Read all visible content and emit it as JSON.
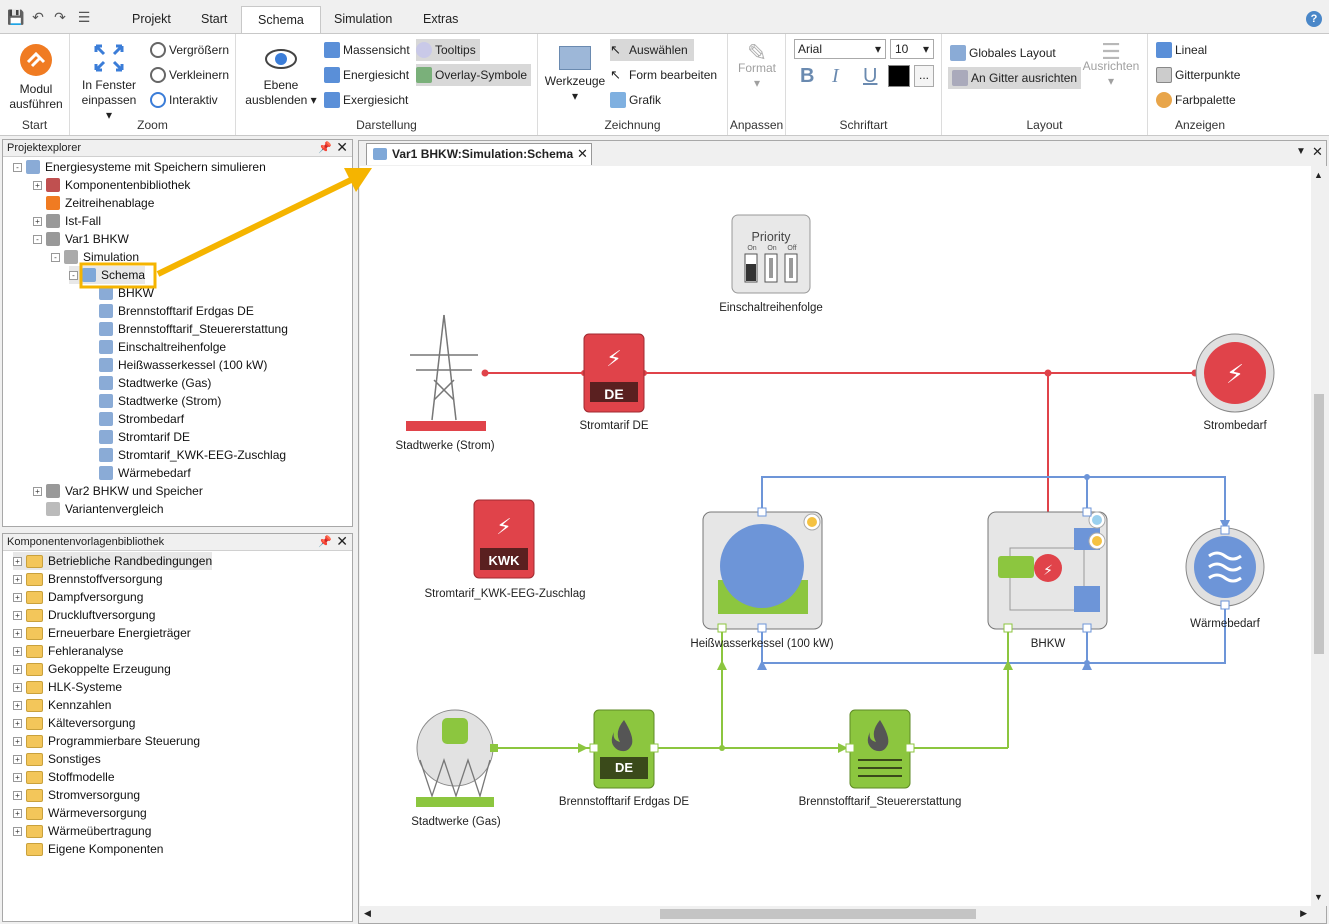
{
  "ribbon_tabs": [
    "Projekt",
    "Start",
    "Schema",
    "Simulation",
    "Extras"
  ],
  "active_tab": "Schema",
  "ribbon": {
    "start": {
      "label": "Start",
      "modul": "Modul",
      "ausfuehren": "ausführen"
    },
    "zoom": {
      "label": "Zoom",
      "in_fenster": "In Fenster",
      "einpassen": "einpassen",
      "vergroessern": "Vergrößern",
      "verkleinern": "Verkleinern",
      "interaktiv": "Interaktiv"
    },
    "darstellung": {
      "label": "Darstellung",
      "ebene": "Ebene",
      "ausblenden": "ausblenden",
      "massensicht": "Massensicht",
      "energiesicht": "Energiesicht",
      "exergiesicht": "Exergiesicht",
      "tooltips": "Tooltips",
      "overlay": "Overlay-Symbole"
    },
    "zeichnung": {
      "label": "Zeichnung",
      "werkzeuge": "Werkzeuge",
      "auswaehlen": "Auswählen",
      "form": "Form bearbeiten",
      "grafik": "Grafik"
    },
    "anpassen": {
      "label": "Anpassen",
      "format": "Format"
    },
    "schriftart": {
      "label": "Schriftart",
      "font": "Arial",
      "size": "10",
      "bold": "B",
      "italic": "I",
      "underline": "U",
      "more": "..."
    },
    "layout": {
      "label": "Layout",
      "globales": "Globales Layout",
      "gitter": "An Gitter ausrichten",
      "ausrichten": "Ausrichten"
    },
    "anzeigen": {
      "label": "Anzeigen",
      "lineal": "Lineal",
      "gitterpunkte": "Gitterpunkte",
      "farbpalette": "Farbpalette"
    }
  },
  "projektexplorer": {
    "title": "Projektexplorer",
    "items": [
      "Energiesysteme mit Speichern simulieren",
      "Komponentenbibliothek",
      "Zeitreihenablage",
      "Ist-Fall",
      "Var1 BHKW",
      "Simulation",
      "Schema",
      "BHKW",
      "Brennstofftarif Erdgas DE",
      "Brennstofftarif_Steuererstattung",
      "Einschaltreihenfolge",
      "Heißwasserkessel (100 kW)",
      "Stadtwerke (Gas)",
      "Stadtwerke (Strom)",
      "Strombedarf",
      "Stromtarif DE",
      "Stromtarif_KWK-EEG-Zuschlag",
      "Wärmebedarf",
      "Var2 BHKW und Speicher",
      "Variantenvergleich"
    ]
  },
  "bibliothek": {
    "title": "Komponentenvorlagenbibliothek",
    "items": [
      "Betriebliche Randbedingungen",
      "Brennstoffversorgung",
      "Dampfversorgung",
      "Druckluftversorgung",
      "Erneuerbare Energieträger",
      "Fehleranalyse",
      "Gekoppelte Erzeugung",
      "HLK-Systeme",
      "Kennzahlen",
      "Kälteversorgung",
      "Programmierbare Steuerung",
      "Sonstiges",
      "Stoffmodelle",
      "Stromversorgung",
      "Wärmeversorgung",
      "Wärmeübertragung",
      "Eigene Komponenten"
    ]
  },
  "document_tab": "Var1 BHKW:Simulation:Schema",
  "schema": {
    "priority_title": "Priority",
    "priority_states": [
      "On",
      "On",
      "Off"
    ],
    "labels": {
      "einschalt": "Einschaltreihenfolge",
      "stadtwerke_strom": "Stadtwerke (Strom)",
      "stromtarif": "Stromtarif DE",
      "strombedarf": "Strombedarf",
      "kwk": "Stromtarif_KWK-EEG-Zuschlag",
      "kessel": "Heißwasserkessel (100 kW)",
      "bhkw": "BHKW",
      "waermebedarf": "Wärmebedarf",
      "stadtwerke_gas": "Stadtwerke (Gas)",
      "brennstoff_erdgas": "Brennstofftarif Erdgas DE",
      "brennstoff_steuer": "Brennstofftarif_Steuererstattung"
    },
    "badge_de": "DE",
    "badge_kwk": "KWK"
  },
  "colors": {
    "electric": "#e0434a",
    "heat": "#6d95d8",
    "gas": "#8cc63f",
    "highlight": "#f5b400"
  }
}
